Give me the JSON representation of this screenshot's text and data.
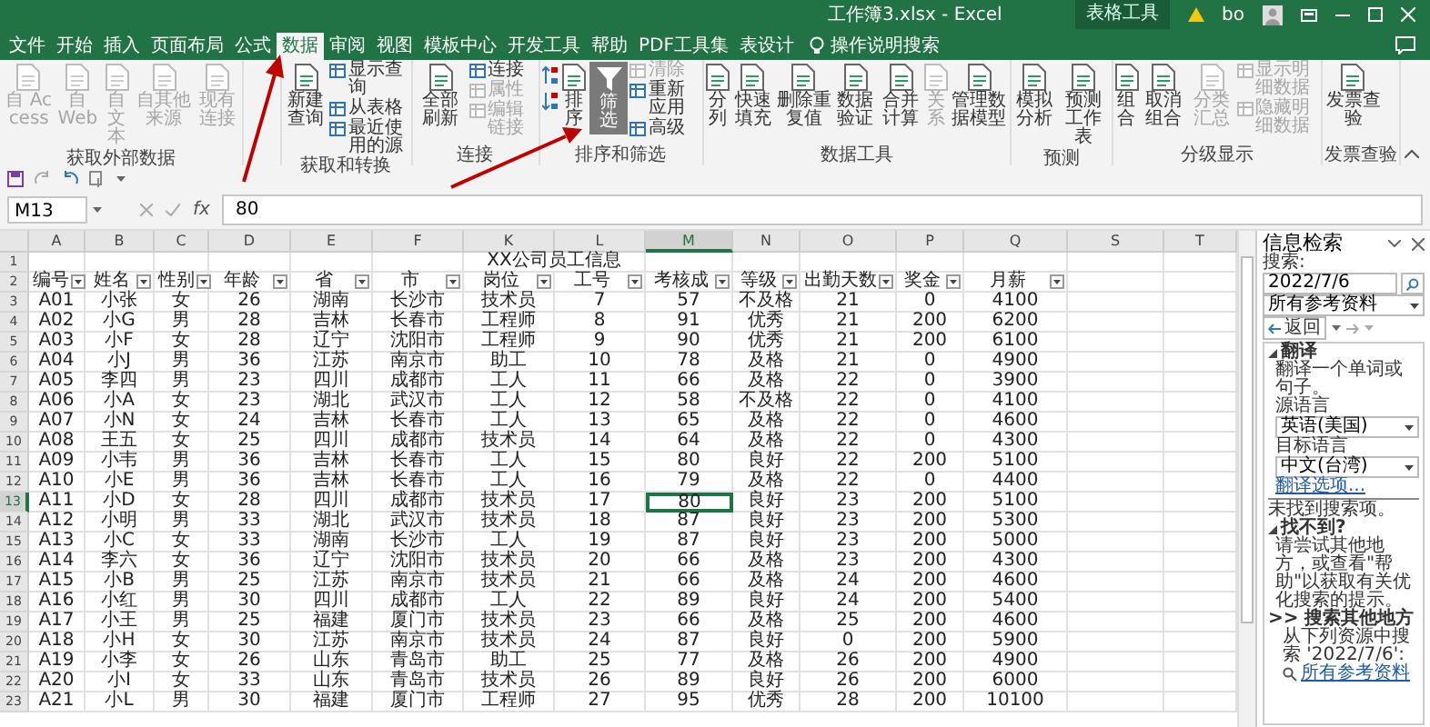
{
  "window": {
    "title": "工作簿3.xlsx - Excel",
    "context_label": "表格工具",
    "user": "bo"
  },
  "tabs": [
    {
      "label": "文件",
      "selected": false
    },
    {
      "label": "开始",
      "selected": false
    },
    {
      "label": "插入",
      "selected": false
    },
    {
      "label": "页面布局",
      "selected": false
    },
    {
      "label": "公式",
      "selected": false
    },
    {
      "label": "数据",
      "selected": true
    },
    {
      "label": "审阅",
      "selected": false
    },
    {
      "label": "视图",
      "selected": false
    },
    {
      "label": "模板中心",
      "selected": false
    },
    {
      "label": "开发工具",
      "selected": false
    },
    {
      "label": "帮助",
      "selected": false
    },
    {
      "label": "PDF工具集",
      "selected": false
    },
    {
      "label": "表设计",
      "selected": false
    }
  ],
  "tell_me": "操作说明搜索",
  "ribbon": {
    "groups": [
      {
        "label": "获取外部数据",
        "items": [
          {
            "label": "自 Access",
            "kind": "large",
            "disabled": true,
            "pressed": false
          },
          {
            "label": "自 Web",
            "kind": "large",
            "disabled": true,
            "pressed": false
          },
          {
            "label": "自文本",
            "kind": "large",
            "disabled": true,
            "pressed": false
          },
          {
            "label": "自其他来源",
            "kind": "large",
            "disabled": true,
            "pressed": false
          },
          {
            "label": "现有连接",
            "kind": "large",
            "disabled": true,
            "pressed": false
          }
        ]
      },
      {
        "label": "获取和转换",
        "items": [
          {
            "label": "新建查询",
            "kind": "large",
            "disabled": false,
            "pressed": false
          },
          {
            "label": "显示查询",
            "kind": "small",
            "disabled": false,
            "pressed": false
          },
          {
            "label": "从表格",
            "kind": "small",
            "disabled": false,
            "pressed": false
          },
          {
            "label": "最近使用的源",
            "kind": "small",
            "disabled": false,
            "pressed": false
          }
        ]
      },
      {
        "label": "连接",
        "items": [
          {
            "label": "全部刷新",
            "kind": "large",
            "disabled": false,
            "pressed": false
          },
          {
            "label": "连接",
            "kind": "small",
            "disabled": false,
            "pressed": false
          },
          {
            "label": "属性",
            "kind": "small",
            "disabled": true,
            "pressed": false
          },
          {
            "label": "编辑链接",
            "kind": "small",
            "disabled": true,
            "pressed": false
          }
        ]
      },
      {
        "label": "排序和筛选",
        "items": [
          {
            "kind": "sort-up",
            "disabled": false,
            "pressed": false
          },
          {
            "kind": "sort-down",
            "disabled": false,
            "pressed": false
          },
          {
            "label": "排序",
            "kind": "large",
            "disabled": false,
            "pressed": false
          },
          {
            "label": "筛选",
            "kind": "filter",
            "disabled": false,
            "pressed": true
          },
          {
            "label": "清除",
            "kind": "small",
            "disabled": true,
            "pressed": false
          },
          {
            "label": "重新应用",
            "kind": "small",
            "disabled": false,
            "pressed": false
          },
          {
            "label": "高级",
            "kind": "small",
            "disabled": false,
            "pressed": false
          }
        ]
      },
      {
        "label": "数据工具",
        "items": [
          {
            "label": "分列",
            "kind": "large",
            "disabled": false,
            "pressed": false
          },
          {
            "label": "快速填充",
            "kind": "large",
            "disabled": false,
            "pressed": false
          },
          {
            "label": "删除重复值",
            "kind": "large",
            "disabled": false,
            "pressed": false
          },
          {
            "label": "数据验证",
            "kind": "large",
            "disabled": false,
            "pressed": false
          },
          {
            "label": "合并计算",
            "kind": "large",
            "disabled": false,
            "pressed": false
          },
          {
            "label": "关系",
            "kind": "large",
            "disabled": true,
            "pressed": false
          },
          {
            "label": "管理数据模型",
            "kind": "large",
            "disabled": false,
            "pressed": false
          }
        ]
      },
      {
        "label": "预测",
        "items": [
          {
            "label": "模拟分析",
            "kind": "large",
            "disabled": false,
            "pressed": false
          },
          {
            "label": "预测工作表",
            "kind": "large",
            "disabled": false,
            "pressed": false
          }
        ]
      },
      {
        "label": "分级显示",
        "items": [
          {
            "label": "组合",
            "kind": "large",
            "disabled": false,
            "pressed": false
          },
          {
            "label": "取消组合",
            "kind": "large",
            "disabled": false,
            "pressed": false
          },
          {
            "label": "分类汇总",
            "kind": "large",
            "disabled": true,
            "pressed": false
          },
          {
            "label": "显示明细数据",
            "kind": "small",
            "disabled": true,
            "pressed": false
          },
          {
            "label": "隐藏明细数据",
            "kind": "small",
            "disabled": true,
            "pressed": false
          }
        ]
      },
      {
        "label": "发票查验",
        "items": [
          {
            "label": "发票查验",
            "kind": "large",
            "disabled": false,
            "pressed": false
          }
        ]
      }
    ]
  },
  "formula_bar": {
    "name_box": "M13",
    "fx": "fx",
    "value": "80"
  },
  "sheet": {
    "columns": [
      {
        "letter": "A",
        "selected": false
      },
      {
        "letter": "B",
        "selected": false
      },
      {
        "letter": "C",
        "selected": false
      },
      {
        "letter": "D",
        "selected": false
      },
      {
        "letter": "E",
        "selected": false
      },
      {
        "letter": "F",
        "selected": false
      },
      {
        "letter": "K",
        "selected": false
      },
      {
        "letter": "L",
        "selected": false
      },
      {
        "letter": "M",
        "selected": true
      },
      {
        "letter": "N",
        "selected": false
      },
      {
        "letter": "O",
        "selected": false
      },
      {
        "letter": "P",
        "selected": false
      },
      {
        "letter": "Q",
        "selected": false
      },
      {
        "letter": "S",
        "selected": false
      },
      {
        "letter": "T",
        "selected": false
      }
    ],
    "rows": [
      {
        "number": "1",
        "kind": "title",
        "text": "XX公司员工信息",
        "selected": false
      },
      {
        "number": "2",
        "kind": "header",
        "selected": false,
        "cells": [
          "编号",
          "姓名",
          "性别",
          "年龄",
          "省",
          "市",
          "岗位",
          "工号",
          "考核成",
          "等级",
          "出勤天数",
          "奖金",
          "月薪"
        ]
      },
      {
        "number": "3",
        "kind": "data",
        "selected": false,
        "cells": [
          "A01",
          "小张",
          "女",
          "26",
          "湖南",
          "长沙市",
          "技术员",
          "7",
          "57",
          "不及格",
          "21",
          "0",
          "4100"
        ]
      },
      {
        "number": "4",
        "kind": "data",
        "selected": false,
        "cells": [
          "A02",
          "小G",
          "男",
          "28",
          "吉林",
          "长春市",
          "工程师",
          "8",
          "91",
          "优秀",
          "21",
          "200",
          "6200"
        ]
      },
      {
        "number": "5",
        "kind": "data",
        "selected": false,
        "cells": [
          "A03",
          "小F",
          "女",
          "28",
          "辽宁",
          "沈阳市",
          "工程师",
          "9",
          "90",
          "优秀",
          "21",
          "200",
          "6100"
        ]
      },
      {
        "number": "6",
        "kind": "data",
        "selected": false,
        "cells": [
          "A04",
          "小J",
          "男",
          "36",
          "江苏",
          "南京市",
          "助工",
          "10",
          "78",
          "及格",
          "21",
          "0",
          "4900"
        ]
      },
      {
        "number": "7",
        "kind": "data",
        "selected": false,
        "cells": [
          "A05",
          "李四",
          "男",
          "23",
          "四川",
          "成都市",
          "工人",
          "11",
          "66",
          "及格",
          "22",
          "0",
          "3900"
        ]
      },
      {
        "number": "8",
        "kind": "data",
        "selected": false,
        "cells": [
          "A06",
          "小A",
          "女",
          "23",
          "湖北",
          "武汉市",
          "工人",
          "12",
          "58",
          "不及格",
          "22",
          "0",
          "4100"
        ]
      },
      {
        "number": "9",
        "kind": "data",
        "selected": false,
        "cells": [
          "A07",
          "小N",
          "女",
          "24",
          "吉林",
          "长春市",
          "工人",
          "13",
          "65",
          "及格",
          "22",
          "0",
          "4600"
        ]
      },
      {
        "number": "10",
        "kind": "data",
        "selected": false,
        "cells": [
          "A08",
          "王五",
          "女",
          "25",
          "四川",
          "成都市",
          "技术员",
          "14",
          "64",
          "及格",
          "22",
          "0",
          "4300"
        ]
      },
      {
        "number": "11",
        "kind": "data",
        "selected": false,
        "cells": [
          "A09",
          "小韦",
          "男",
          "36",
          "吉林",
          "长春市",
          "工人",
          "15",
          "80",
          "良好",
          "22",
          "200",
          "5100"
        ]
      },
      {
        "number": "12",
        "kind": "data",
        "selected": false,
        "cells": [
          "A10",
          "小E",
          "男",
          "36",
          "吉林",
          "长春市",
          "工人",
          "16",
          "79",
          "及格",
          "22",
          "0",
          "4400"
        ]
      },
      {
        "number": "13",
        "kind": "data",
        "selected": true,
        "cells": [
          "A11",
          "小D",
          "女",
          "28",
          "四川",
          "成都市",
          "技术员",
          "17",
          "80",
          "良好",
          "23",
          "200",
          "5100"
        ]
      },
      {
        "number": "14",
        "kind": "data",
        "selected": false,
        "cells": [
          "A12",
          "小明",
          "男",
          "33",
          "湖北",
          "武汉市",
          "技术员",
          "18",
          "87",
          "良好",
          "23",
          "200",
          "5300"
        ]
      },
      {
        "number": "15",
        "kind": "data",
        "selected": false,
        "cells": [
          "A13",
          "小C",
          "女",
          "33",
          "湖南",
          "长沙市",
          "工人",
          "19",
          "87",
          "良好",
          "23",
          "200",
          "5000"
        ]
      },
      {
        "number": "16",
        "kind": "data",
        "selected": false,
        "cells": [
          "A14",
          "李六",
          "女",
          "36",
          "辽宁",
          "沈阳市",
          "技术员",
          "20",
          "66",
          "及格",
          "23",
          "200",
          "4300"
        ]
      },
      {
        "number": "17",
        "kind": "data",
        "selected": false,
        "cells": [
          "A15",
          "小B",
          "男",
          "25",
          "江苏",
          "南京市",
          "技术员",
          "21",
          "66",
          "及格",
          "24",
          "200",
          "4600"
        ]
      },
      {
        "number": "18",
        "kind": "data",
        "selected": false,
        "cells": [
          "A16",
          "小红",
          "男",
          "30",
          "四川",
          "成都市",
          "工人",
          "22",
          "89",
          "良好",
          "24",
          "200",
          "5400"
        ]
      },
      {
        "number": "19",
        "kind": "data",
        "selected": false,
        "cells": [
          "A17",
          "小王",
          "男",
          "25",
          "福建",
          "厦门市",
          "技术员",
          "23",
          "66",
          "及格",
          "25",
          "200",
          "4600"
        ]
      },
      {
        "number": "20",
        "kind": "data",
        "selected": false,
        "cells": [
          "A18",
          "小H",
          "女",
          "30",
          "江苏",
          "南京市",
          "技术员",
          "24",
          "87",
          "良好",
          "0",
          "200",
          "5900"
        ]
      },
      {
        "number": "21",
        "kind": "data",
        "selected": false,
        "cells": [
          "A19",
          "小李",
          "女",
          "26",
          "山东",
          "青岛市",
          "助工",
          "25",
          "77",
          "及格",
          "26",
          "200",
          "4900"
        ]
      },
      {
        "number": "22",
        "kind": "data",
        "selected": false,
        "cells": [
          "A20",
          "小I",
          "女",
          "33",
          "山东",
          "青岛市",
          "技术员",
          "26",
          "89",
          "良好",
          "26",
          "200",
          "6000"
        ]
      },
      {
        "number": "23",
        "kind": "data",
        "selected": false,
        "cells": [
          "A21",
          "小L",
          "男",
          "30",
          "福建",
          "厦门市",
          "工程师",
          "27",
          "95",
          "优秀",
          "28",
          "200",
          "10100"
        ]
      }
    ]
  },
  "side_panel": {
    "title": "信息检索",
    "search_label": "搜索:",
    "search_value": "2022/7/6",
    "source": "所有参考资料",
    "back": "返回",
    "translate_heading": "翻译",
    "translate_hint": "翻译一个单词或句子。",
    "source_language_label": "源语言",
    "source_language": "英语(美国)",
    "target_language_label": "目标语言",
    "target_language": "中文(台湾)",
    "options_link": "翻译选项...",
    "not_found": "未找到搜索项。",
    "cant_find_heading": "找不到?",
    "tip": "请尝试其他地方，或查看\"帮助\"以获取有关优化搜索的提示。",
    "search_elsewhere": ">> 搜索其他地方",
    "search_from": "从下列资源中搜索 '2022/7/6':",
    "all_sources_link": "所有参考资料"
  }
}
